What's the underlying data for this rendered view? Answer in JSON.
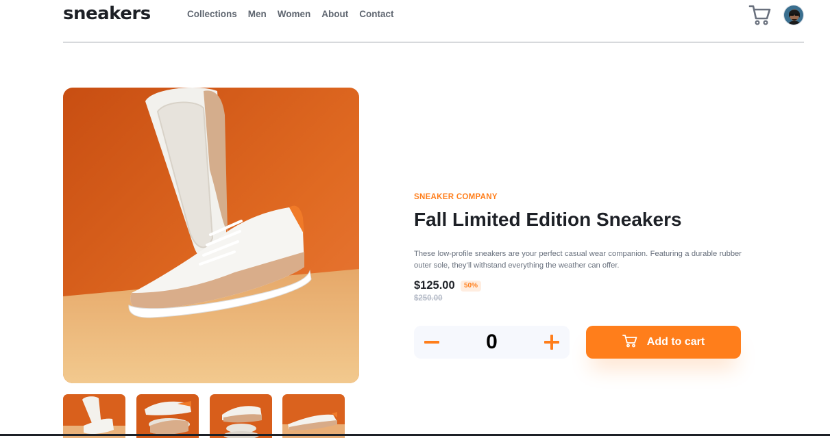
{
  "header": {
    "logo": "sneakers",
    "nav": [
      "Collections",
      "Men",
      "Women",
      "About",
      "Contact"
    ],
    "cart_icon": "cart-icon",
    "avatar_icon": "user-avatar"
  },
  "gallery": {
    "main_image": "sneaker-product-photo",
    "thumbnails": [
      "thumbnail-1",
      "thumbnail-2",
      "thumbnail-3",
      "thumbnail-4"
    ]
  },
  "product": {
    "company": "SNEAKER COMPANY",
    "title": "Fall Limited Edition Sneakers",
    "description": "These low-profile sneakers are your perfect casual wear companion. Featuring a durable rubber outer sole, they’ll withstand everything the weather can offer.",
    "price": "$125.00",
    "discount": "50%",
    "original_price": "$250.00"
  },
  "cart_controls": {
    "minus_icon": "minus-icon",
    "quantity": "0",
    "plus_icon": "plus-icon",
    "add_to_cart_label": "Add to cart",
    "cart_button_icon": "cart-icon"
  },
  "colors": {
    "accent": "#ff7e1b",
    "accent_pale": "#ffede0",
    "text_dark": "#1d2026",
    "text_grey": "#68707d",
    "qty_bg": "#f6f8fd"
  }
}
